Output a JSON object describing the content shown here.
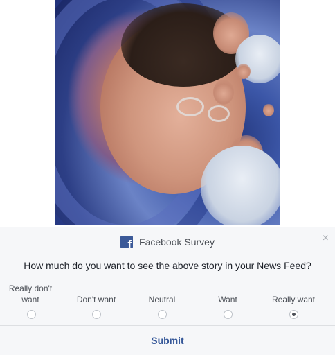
{
  "story": {
    "image_alt": ""
  },
  "survey": {
    "title": "Facebook Survey",
    "logo_letter": "f",
    "close_symbol": "×",
    "question": "How much do you want to see the above story in your News Feed?",
    "options": [
      {
        "label": "Really don't want",
        "selected": false
      },
      {
        "label": "Don't want",
        "selected": false
      },
      {
        "label": "Neutral",
        "selected": false
      },
      {
        "label": "Want",
        "selected": false
      },
      {
        "label": "Really want",
        "selected": true
      }
    ],
    "submit_label": "Submit",
    "icons": {
      "logo": "facebook-logo-icon",
      "close": "close-icon"
    },
    "colors": {
      "brand": "#3b5998",
      "link": "#365899",
      "panel_bg": "#f6f7f9"
    }
  }
}
